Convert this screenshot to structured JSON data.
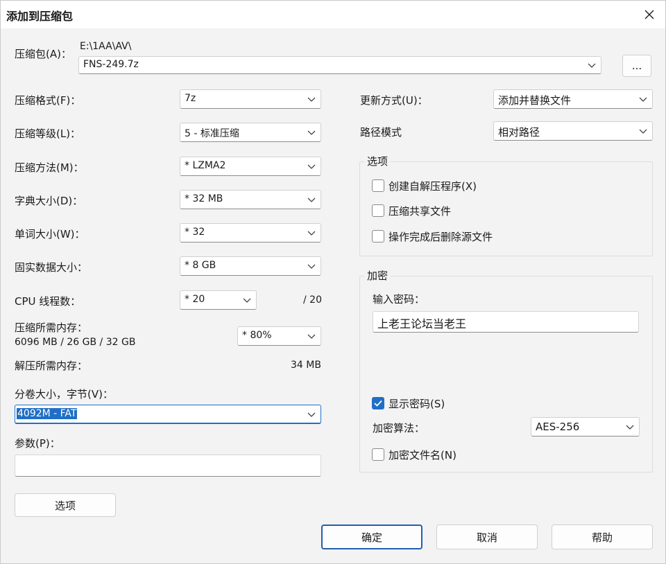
{
  "window": {
    "title": "添加到压缩包"
  },
  "archive": {
    "label": "压缩包(A)：",
    "path": "E:\\1AA\\AV\\",
    "name": "FNS-249.7z",
    "browse_label": "..."
  },
  "format": {
    "label": "压缩格式(F)：",
    "value": "7z"
  },
  "level": {
    "label": "压缩等级(L)：",
    "value": "5 - 标准压缩"
  },
  "method": {
    "label": "压缩方法(M)：",
    "value": "* LZMA2"
  },
  "dict": {
    "label": "字典大小(D)：",
    "value": "* 32 MB"
  },
  "word": {
    "label": "单词大小(W)：",
    "value": "* 32"
  },
  "solid": {
    "label": "固实数据大小：",
    "value": "* 8 GB"
  },
  "threads": {
    "label": "CPU 线程数：",
    "value": "* 20",
    "max": "/ 20"
  },
  "memory": {
    "label": "压缩所需内存：",
    "detail": "6096 MB / 26 GB / 32 GB",
    "value": "* 80%",
    "decomp_label": "解压所需内存：",
    "decomp_value": "34 MB"
  },
  "volume": {
    "label": "分卷大小，字节(V)：",
    "value": "4092M - FAT"
  },
  "params": {
    "label": "参数(P)：",
    "value": ""
  },
  "update": {
    "label": "更新方式(U)：",
    "value": "添加并替换文件"
  },
  "pathmode": {
    "label": "路径模式",
    "value": "相对路径"
  },
  "options": {
    "title": "选项",
    "items": [
      {
        "label": "创建自解压程序(X)",
        "checked": false
      },
      {
        "label": "压缩共享文件",
        "checked": false
      },
      {
        "label": "操作完成后删除源文件",
        "checked": false
      }
    ]
  },
  "encryption": {
    "title": "加密",
    "password_label": "输入密码：",
    "password": "上老王论坛当老王",
    "show_password": {
      "label": "显示密码(S)",
      "checked": true
    },
    "method_label": "加密算法：",
    "method": "AES-256",
    "encrypt_names": {
      "label": "加密文件名(N)",
      "checked": false
    }
  },
  "buttons": {
    "options": "选项",
    "ok": "确定",
    "cancel": "取消",
    "help": "帮助"
  }
}
